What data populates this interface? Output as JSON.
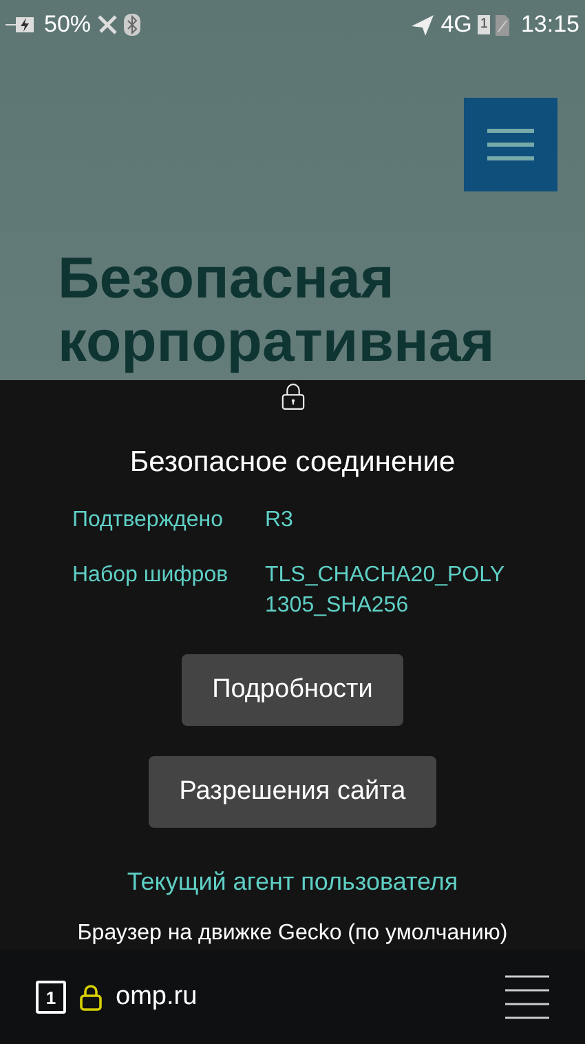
{
  "status_bar": {
    "battery": "50%",
    "network": "4G",
    "sim": "1",
    "time": "13:15"
  },
  "page": {
    "heading": "Безопасная корпоративная"
  },
  "security_dialog": {
    "title": "Безопасное соединение",
    "details": [
      {
        "label": "Подтверждено",
        "value": "R3"
      },
      {
        "label": "Набор шифров",
        "value": "TLS_CHACHA20_POLY1305_SHA256"
      }
    ],
    "buttons": [
      "Подробности",
      "Разрешения сайта"
    ],
    "user_agent_link": "Текущий агент пользователя",
    "user_agent_value": "Браузер на движке Gecko (по умолчанию)"
  },
  "toolbar": {
    "tab_count": "1",
    "url": "omp.ru"
  }
}
